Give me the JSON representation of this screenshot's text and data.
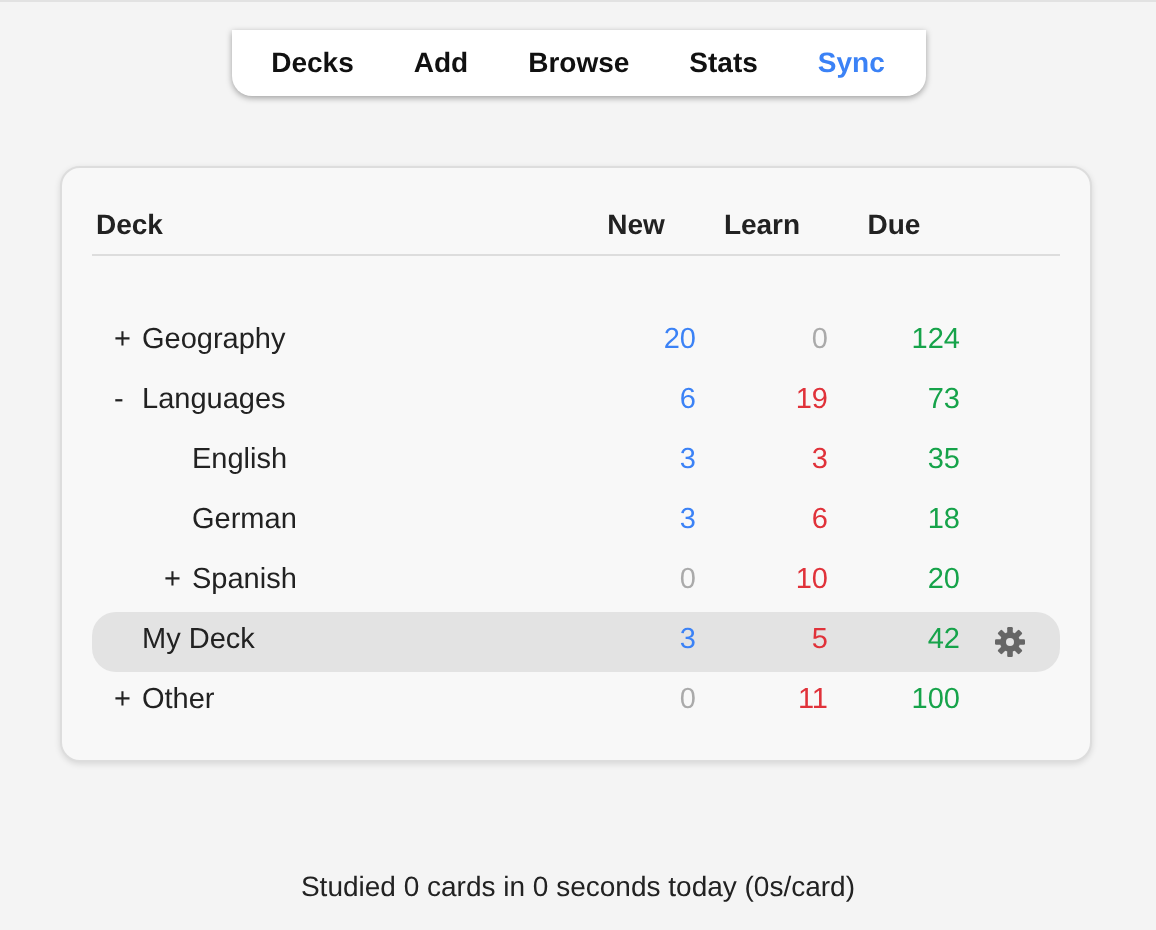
{
  "toolbar": [
    {
      "label": "Decks",
      "selected": false
    },
    {
      "label": "Add",
      "selected": false
    },
    {
      "label": "Browse",
      "selected": false
    },
    {
      "label": "Stats",
      "selected": false
    },
    {
      "label": "Sync",
      "selected": true
    }
  ],
  "deck_table": {
    "columns": [
      "Deck",
      "New",
      "Learn",
      "Due"
    ],
    "decks": [
      {
        "toggle": "+",
        "name": "Geography",
        "selected": false,
        "new": {
          "value": "20",
          "dimmed": false
        },
        "learn": {
          "value": "0",
          "dimmed": true
        },
        "due": {
          "value": "124",
          "dimmed": false
        }
      },
      {
        "toggle": "-",
        "name": "Languages",
        "selected": false,
        "new": {
          "value": "6",
          "dimmed": false
        },
        "learn": {
          "value": "19",
          "dimmed": false
        },
        "due": {
          "value": "73",
          "dimmed": false
        },
        "children": [
          {
            "name": "English",
            "selected": false,
            "new": {
              "value": "3",
              "dimmed": false
            },
            "learn": {
              "value": "3",
              "dimmed": false
            },
            "due": {
              "value": "35",
              "dimmed": false
            }
          },
          {
            "name": "German",
            "selected": false,
            "new": {
              "value": "3",
              "dimmed": false
            },
            "learn": {
              "value": "6",
              "dimmed": false
            },
            "due": {
              "value": "18",
              "dimmed": false
            }
          },
          {
            "toggle": "+",
            "name": "Spanish",
            "selected": false,
            "new": {
              "value": "0",
              "dimmed": true
            },
            "learn": {
              "value": "10",
              "dimmed": false
            },
            "due": {
              "value": "20",
              "dimmed": false
            }
          }
        ]
      },
      {
        "name": "My Deck",
        "selected": true,
        "new": {
          "value": "3",
          "dimmed": false
        },
        "learn": {
          "value": "5",
          "dimmed": false
        },
        "due": {
          "value": "42",
          "dimmed": false
        }
      },
      {
        "toggle": "+",
        "name": "Other",
        "selected": false,
        "new": {
          "value": "0",
          "dimmed": true
        },
        "learn": {
          "value": "11",
          "dimmed": false
        },
        "due": {
          "value": "100",
          "dimmed": false
        }
      }
    ]
  },
  "footer": "Studied 0 cards in 0 seconds today (0s/card)"
}
